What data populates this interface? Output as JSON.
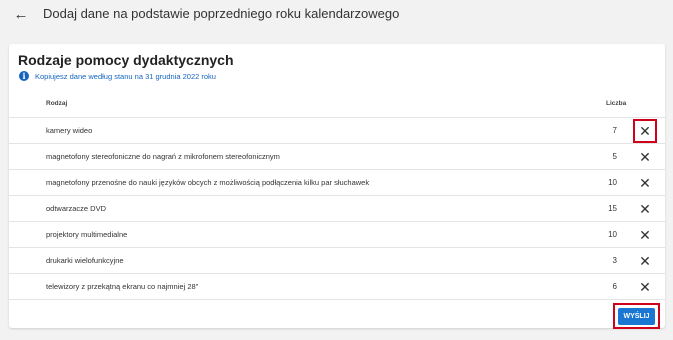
{
  "header": {
    "back_icon": "←",
    "title": "Dodaj dane na podstawie poprzedniego roku kalendarzowego"
  },
  "card": {
    "title": "Rodzaje pomocy dydaktycznych",
    "info_icon": "i",
    "info_text": "Kopiujesz dane według stanu na 31 grudnia 2022 roku",
    "columns": {
      "rodzaj": "Rodzaj",
      "liczba": "Liczba"
    },
    "rows": [
      {
        "name": "kamery wideo",
        "count": "7"
      },
      {
        "name": "magnetofony stereofoniczne do nagrań z mikrofonem stereofonicznym",
        "count": "5"
      },
      {
        "name": "magnetofony przenośne do nauki języków obcych z możliwością podłączenia kilku par słuchawek",
        "count": "10"
      },
      {
        "name": "odtwarzacze DVD",
        "count": "15"
      },
      {
        "name": "projektory multimedialne",
        "count": "10"
      },
      {
        "name": "drukarki wielofunkcyjne",
        "count": "3"
      },
      {
        "name": "telewizory z przekątną ekranu co najmniej 28\"",
        "count": "6"
      }
    ],
    "delete_icon": "✕",
    "send_label": "WYŚLIJ"
  },
  "colors": {
    "accent": "#1976d2",
    "highlight": "#d0021b"
  }
}
